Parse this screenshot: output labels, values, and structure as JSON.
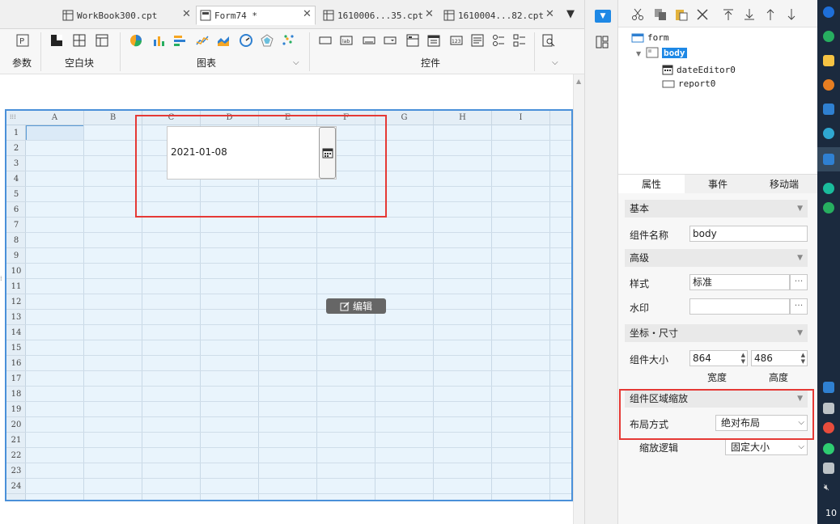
{
  "tabs": [
    {
      "label": "WorkBook300.cpt",
      "active": false
    },
    {
      "label": "Form74 *",
      "active": true
    },
    {
      "label": "1610006...35.cpt",
      "active": false
    },
    {
      "label": "1610004...82.cpt",
      "active": false
    }
  ],
  "ribbon": {
    "groups": [
      "参数",
      "空白块",
      "图表",
      "控件"
    ]
  },
  "grid": {
    "columns": [
      "A",
      "B",
      "C",
      "D",
      "E",
      "F",
      "G",
      "H",
      "I"
    ],
    "rows": [
      "1",
      "2",
      "3",
      "4",
      "5",
      "6",
      "7",
      "8",
      "9",
      "10",
      "11",
      "12",
      "13",
      "14",
      "15",
      "16",
      "17",
      "18",
      "19",
      "20",
      "21",
      "22",
      "23",
      "24"
    ]
  },
  "date_editor": {
    "value": "2021-01-08"
  },
  "edit_button": {
    "label": "编辑"
  },
  "tree": {
    "root": "form",
    "body": "body",
    "children": [
      "dateEditor0",
      "report0"
    ]
  },
  "panel_tabs": [
    "属性",
    "事件",
    "移动端"
  ],
  "props": {
    "basic_section": "基本",
    "name_label": "组件名称",
    "name_value": "body",
    "advanced_section": "高级",
    "style_label": "样式",
    "style_value": "标准",
    "watermark_label": "水印",
    "watermark_value": "",
    "coord_section": "坐标・尺寸",
    "size_label": "组件大小",
    "width_value": "864",
    "height_value": "486",
    "width_caption": "宽度",
    "height_caption": "高度",
    "scale_section": "组件区域缩放",
    "layout_label": "布局方式",
    "layout_value": "绝对布局",
    "scale_label": "缩放逻辑",
    "scale_value": "固定大小"
  },
  "taskbar": {
    "clock_partial": "10"
  },
  "colors": {
    "accent": "#4a90d9",
    "highlight_red": "#e53935",
    "selection_blue": "#1e88e5"
  }
}
